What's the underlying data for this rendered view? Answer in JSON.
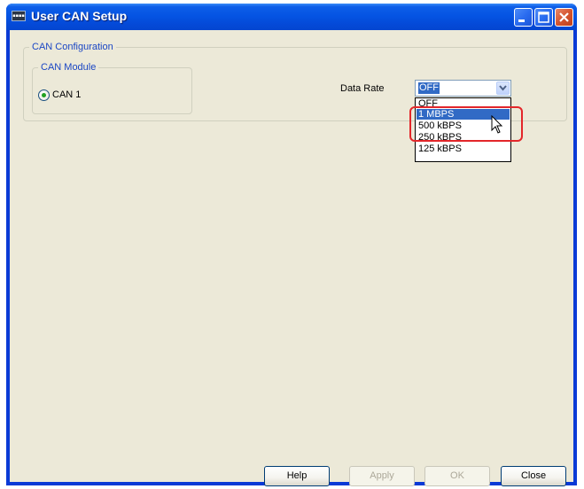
{
  "window": {
    "title": "User CAN Setup",
    "icon_text": "▪▪▪▪"
  },
  "can_configuration": {
    "group_label": "CAN Configuration",
    "module_group_label": "CAN Module",
    "module_option_label": "CAN 1",
    "module_option_checked": true,
    "data_rate_label": "Data Rate",
    "data_rate_value": "OFF",
    "data_rate_options": [
      {
        "label": "OFF",
        "highlighted": false
      },
      {
        "label": "1 MBPS",
        "highlighted": true
      },
      {
        "label": "500 kBPS",
        "highlighted": false
      },
      {
        "label": "250 kBPS",
        "highlighted": false
      },
      {
        "label": "125 kBPS",
        "highlighted": false
      }
    ]
  },
  "buttons": {
    "help": {
      "label": "Help",
      "enabled": true
    },
    "apply": {
      "label": "Apply",
      "enabled": false
    },
    "ok": {
      "label": "OK",
      "enabled": false
    },
    "close": {
      "label": "Close",
      "enabled": true
    }
  },
  "colors": {
    "titlebar": "#0554e3",
    "dialog_background": "#ece9d8",
    "selection": "#316ac5",
    "group_label_text": "#1a46c4",
    "annotation_red": "#e3262a"
  },
  "icons": [
    "minimize-icon",
    "maximize-icon",
    "close-icon",
    "chevron-down-icon",
    "mouse-cursor-icon"
  ]
}
